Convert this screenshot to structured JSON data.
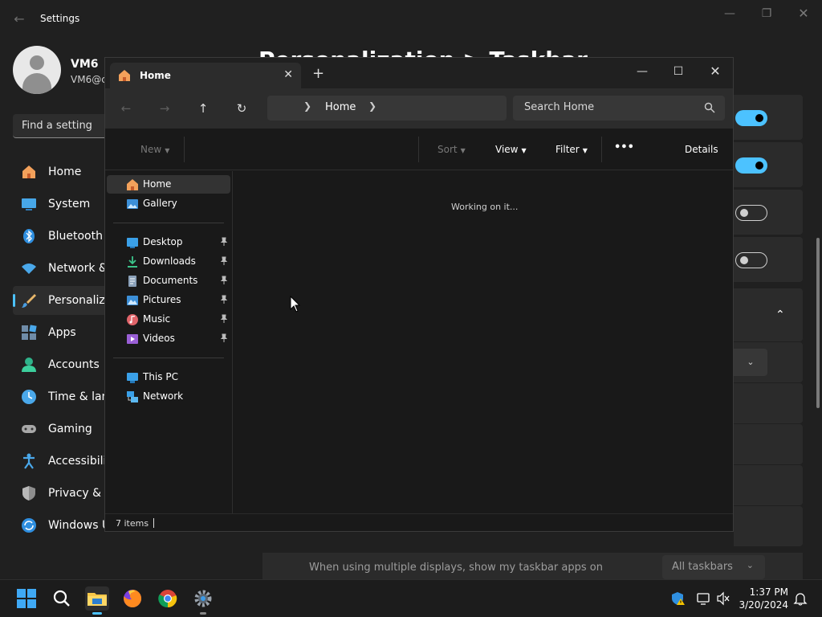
{
  "settings": {
    "app_title": "Settings",
    "user_name": "VM6",
    "user_email": "VM6@c",
    "search_placeholder": "Find a setting",
    "page_title": "Personalization > Taskbar",
    "nav": [
      {
        "label": "Home",
        "icon": "home-icon"
      },
      {
        "label": "System",
        "icon": "system-icon"
      },
      {
        "label": "Bluetooth &",
        "icon": "bluetooth-icon"
      },
      {
        "label": "Network &",
        "icon": "wifi-icon"
      },
      {
        "label": "Personaliza",
        "icon": "brush-icon",
        "selected": true
      },
      {
        "label": "Apps",
        "icon": "apps-icon"
      },
      {
        "label": "Accounts",
        "icon": "account-icon"
      },
      {
        "label": "Time & lang",
        "icon": "clock-icon"
      },
      {
        "label": "Gaming",
        "icon": "gamepad-icon"
      },
      {
        "label": "Accessibility",
        "icon": "accessibility-icon"
      },
      {
        "label": "Privacy & se",
        "icon": "shield-icon"
      },
      {
        "label": "Windows U",
        "icon": "update-icon"
      }
    ],
    "toggles": [
      true,
      true,
      false,
      false
    ],
    "multi_display_label": "When using multiple displays, show my taskbar apps on",
    "multi_display_value": "All taskbars",
    "accent_color": "#4cc2ff"
  },
  "explorer": {
    "tab_title": "Home",
    "breadcrumb": "Home",
    "search_placeholder": "Search Home",
    "toolbar": {
      "new": "New",
      "sort": "Sort",
      "view": "View",
      "filter": "Filter",
      "more": "•••",
      "details": "Details"
    },
    "sidebar": {
      "top": [
        {
          "label": "Home",
          "icon": "home-icon",
          "selected": true
        },
        {
          "label": "Gallery",
          "icon": "gallery-icon"
        }
      ],
      "pinned": [
        {
          "label": "Desktop",
          "icon": "desktop-icon"
        },
        {
          "label": "Downloads",
          "icon": "download-icon"
        },
        {
          "label": "Documents",
          "icon": "documents-icon"
        },
        {
          "label": "Pictures",
          "icon": "pictures-icon"
        },
        {
          "label": "Music",
          "icon": "music-icon"
        },
        {
          "label": "Videos",
          "icon": "videos-icon"
        }
      ],
      "devices": [
        {
          "label": "This PC",
          "icon": "pc-icon"
        },
        {
          "label": "Network",
          "icon": "network-icon"
        }
      ]
    },
    "content_message": "Working on it...",
    "status_count": "7 items"
  },
  "taskbar": {
    "time": "1:37 PM",
    "date": "3/20/2024"
  }
}
